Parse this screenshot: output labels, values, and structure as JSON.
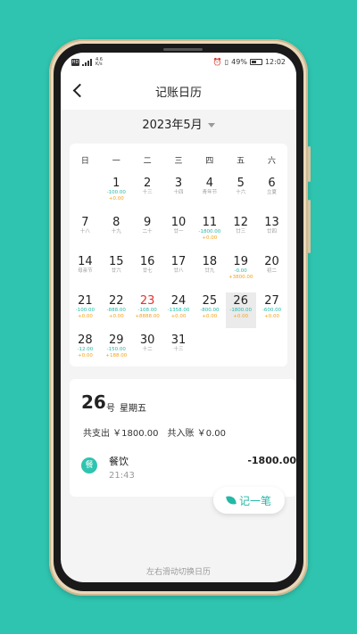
{
  "status": {
    "sim": "HD",
    "net_speed": "4.6 K/s",
    "battery": "49%",
    "time": "12:02"
  },
  "header": {
    "title": "记账日历"
  },
  "month": {
    "label": "2023年5月"
  },
  "weekdays": [
    "日",
    "一",
    "二",
    "三",
    "四",
    "五",
    "六"
  ],
  "days": [
    {
      "d": "1",
      "exp": "-100.00",
      "inc": "+0.00"
    },
    {
      "d": "2",
      "sub": "十三"
    },
    {
      "d": "3",
      "sub": "十四"
    },
    {
      "d": "4",
      "sub": "青年节"
    },
    {
      "d": "5",
      "sub": "十六"
    },
    {
      "d": "6",
      "sub": "立夏"
    },
    {
      "d": "7",
      "sub": "十八"
    },
    {
      "d": "8",
      "sub": "十九"
    },
    {
      "d": "9",
      "sub": "二十"
    },
    {
      "d": "10",
      "sub": "廿一"
    },
    {
      "d": "11",
      "exp": "-1800.00",
      "inc": "+0.00"
    },
    {
      "d": "12",
      "sub": "廿三"
    },
    {
      "d": "13",
      "sub": "廿四"
    },
    {
      "d": "14",
      "sub": "母亲节"
    },
    {
      "d": "15",
      "sub": "廿六"
    },
    {
      "d": "16",
      "sub": "廿七"
    },
    {
      "d": "17",
      "sub": "廿八"
    },
    {
      "d": "18",
      "sub": "廿九"
    },
    {
      "d": "19",
      "exp": "-0.00",
      "inc": "+3800.00"
    },
    {
      "d": "20",
      "sub": "初二"
    },
    {
      "d": "21",
      "exp": "-100.00",
      "inc": "+0.00"
    },
    {
      "d": "22",
      "exp": "-888.00",
      "inc": "+0.00"
    },
    {
      "d": "23",
      "exp": "-108.00",
      "inc": "+8888.00",
      "today": true
    },
    {
      "d": "24",
      "exp": "-1358.00",
      "inc": "+0.00"
    },
    {
      "d": "25",
      "exp": "-800.00",
      "inc": "+0.00"
    },
    {
      "d": "26",
      "exp": "-1800.00",
      "inc": "+0.00",
      "selected": true
    },
    {
      "d": "27",
      "exp": "-600.00",
      "inc": "+0.00"
    },
    {
      "d": "28",
      "exp": "-12.00",
      "inc": "+0.00"
    },
    {
      "d": "29",
      "exp": "-150.00",
      "inc": "+188.00"
    },
    {
      "d": "30",
      "sub": "十二"
    },
    {
      "d": "31",
      "sub": "十三"
    }
  ],
  "first_weekday_index": 1,
  "detail": {
    "day": "26",
    "day_unit": "号",
    "weekday": "星期五",
    "totals": "共支出 ￥1800.00　共入账 ￥0.00",
    "record": {
      "icon_char": "餐",
      "category": "餐饮",
      "time": "21:43",
      "amount": "-1800.00"
    }
  },
  "record_button": {
    "label": "记一笔"
  },
  "hint": "左右滑动切换日历",
  "colors": {
    "accent": "#2fc4af",
    "expense": "#24b8a6",
    "income": "#f2a21b",
    "today": "#e23333"
  }
}
